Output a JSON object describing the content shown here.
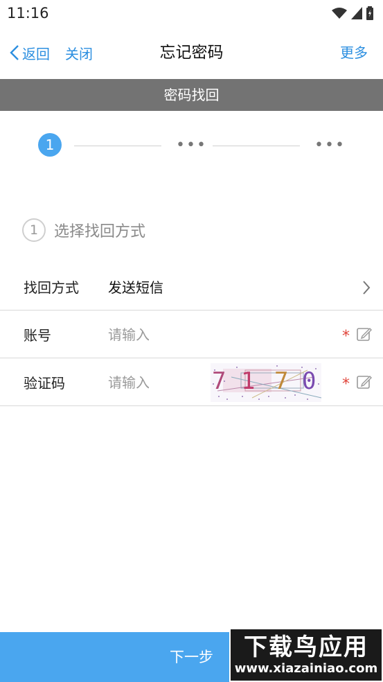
{
  "status": {
    "time": "11:16"
  },
  "nav": {
    "back_label": "返回",
    "close_label": "关闭",
    "title": "忘记密码",
    "more_label": "更多"
  },
  "section": {
    "title": "密码找回"
  },
  "steps": {
    "current": "1",
    "dots": "•••"
  },
  "step_title": {
    "num": "1",
    "label": "选择找回方式"
  },
  "form": {
    "method": {
      "label": "找回方式",
      "value": "发送短信"
    },
    "account": {
      "label": "账号",
      "placeholder": "请输入",
      "required": "*"
    },
    "captcha": {
      "label": "验证码",
      "placeholder": "请输入",
      "required": "*",
      "code": [
        "7",
        "1",
        "7",
        "0"
      ]
    }
  },
  "footer": {
    "next_label": "下一步"
  },
  "watermark": {
    "line1": "下载鸟应用",
    "line2": "www.xiazainiao.com"
  },
  "colors": {
    "accent": "#4aa6ef",
    "link": "#2c8fe0",
    "section_bar": "#737373",
    "required": "#e0443a"
  }
}
